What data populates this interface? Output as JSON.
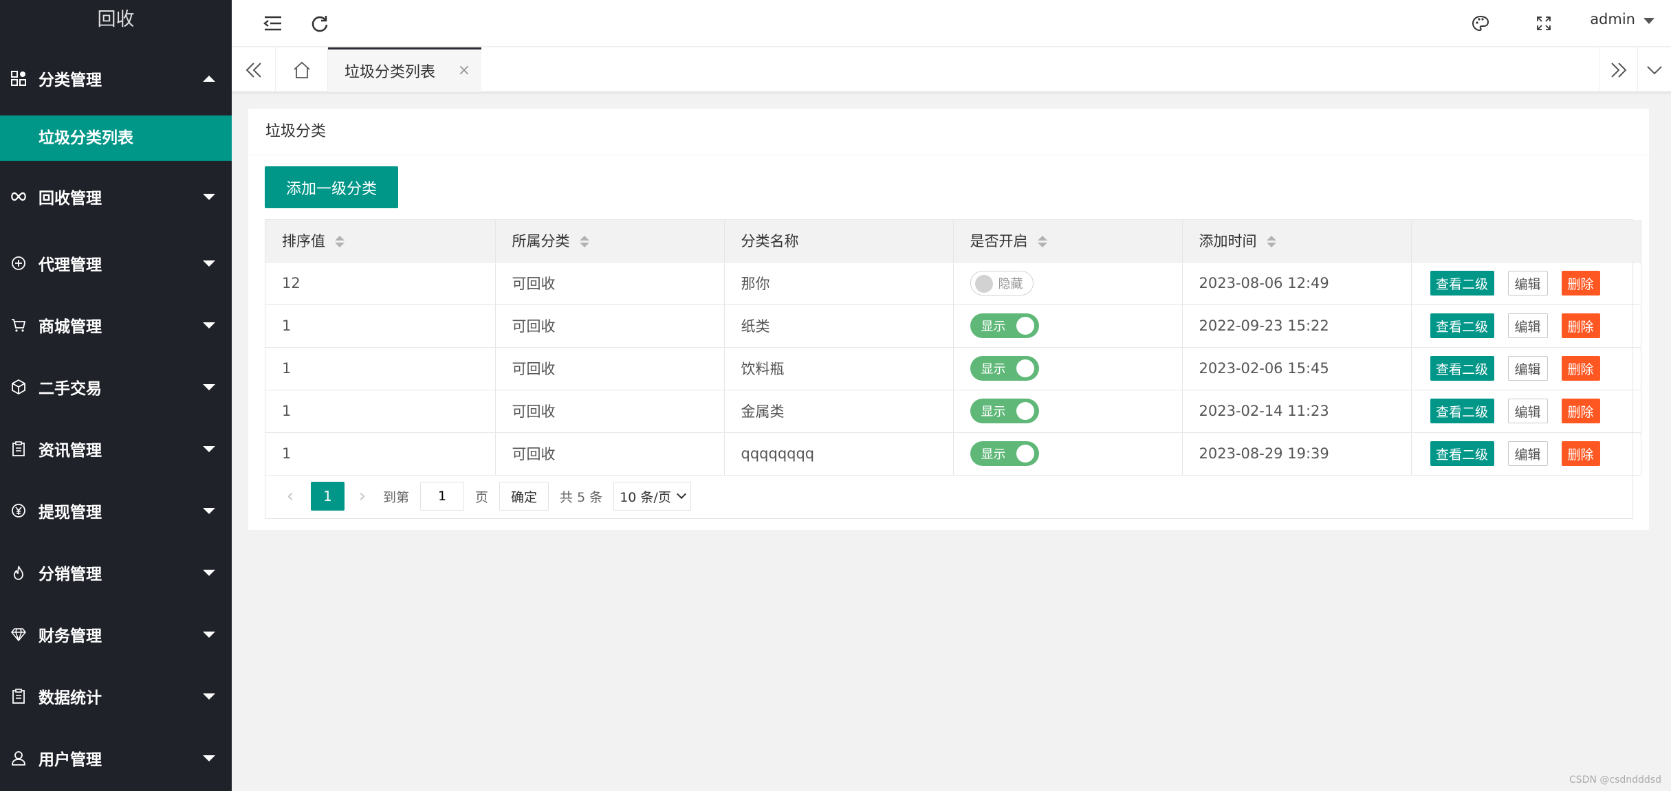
{
  "sidebar": {
    "logo": "回收",
    "menu": [
      {
        "label": "分类管理",
        "icon": "grid-icon",
        "expanded": true
      },
      {
        "label": "回收管理",
        "icon": "infinity-icon"
      },
      {
        "label": "代理管理",
        "icon": "plus-circle-icon"
      },
      {
        "label": "商城管理",
        "icon": "cart-icon"
      },
      {
        "label": "二手交易",
        "icon": "box-icon"
      },
      {
        "label": "资讯管理",
        "icon": "clipboard-icon"
      },
      {
        "label": "提现管理",
        "icon": "yen-circle-icon"
      },
      {
        "label": "分销管理",
        "icon": "fire-icon"
      },
      {
        "label": "财务管理",
        "icon": "diamond-icon"
      },
      {
        "label": "数据统计",
        "icon": "clipboard-icon"
      },
      {
        "label": "用户管理",
        "icon": "user-icon"
      }
    ],
    "submenu": {
      "label": "垃圾分类列表"
    }
  },
  "header": {
    "user": "admin"
  },
  "tabs": {
    "active_label": "垃圾分类列表",
    "close": "×"
  },
  "card": {
    "title": "垃圾分类",
    "add_button": "添加一级分类"
  },
  "table": {
    "headers": [
      "排序值",
      "所属分类",
      "分类名称",
      "是否开启",
      "添加时间",
      ""
    ],
    "rows": [
      {
        "sort": "12",
        "parent": "可回收",
        "name": "那你",
        "status": "隐藏",
        "on": false,
        "time": "2023-08-06 12:49"
      },
      {
        "sort": "1",
        "parent": "可回收",
        "name": "纸类",
        "status": "显示",
        "on": true,
        "time": "2022-09-23 15:22"
      },
      {
        "sort": "1",
        "parent": "可回收",
        "name": "饮料瓶",
        "status": "显示",
        "on": true,
        "time": "2023-02-06 15:45"
      },
      {
        "sort": "1",
        "parent": "可回收",
        "name": "金属类",
        "status": "显示",
        "on": true,
        "time": "2023-02-14 11:23"
      },
      {
        "sort": "1",
        "parent": "可回收",
        "name": "qqqqqqqq",
        "status": "显示",
        "on": true,
        "time": "2023-08-29 19:39"
      }
    ],
    "actions": {
      "view": "查看二级",
      "edit": "编辑",
      "delete": "删除"
    }
  },
  "pager": {
    "current": "1",
    "goto_label": "到第",
    "goto_value": "1",
    "page_label": "页",
    "confirm": "确定",
    "total": "共 5 条",
    "page_size": "10 条/页"
  },
  "watermark": "CSDN @csdndddsd",
  "colors": {
    "sidebar_bg": "#20222a",
    "accent": "#009688",
    "switch_on": "#5fb878",
    "danger": "#ff5722"
  }
}
